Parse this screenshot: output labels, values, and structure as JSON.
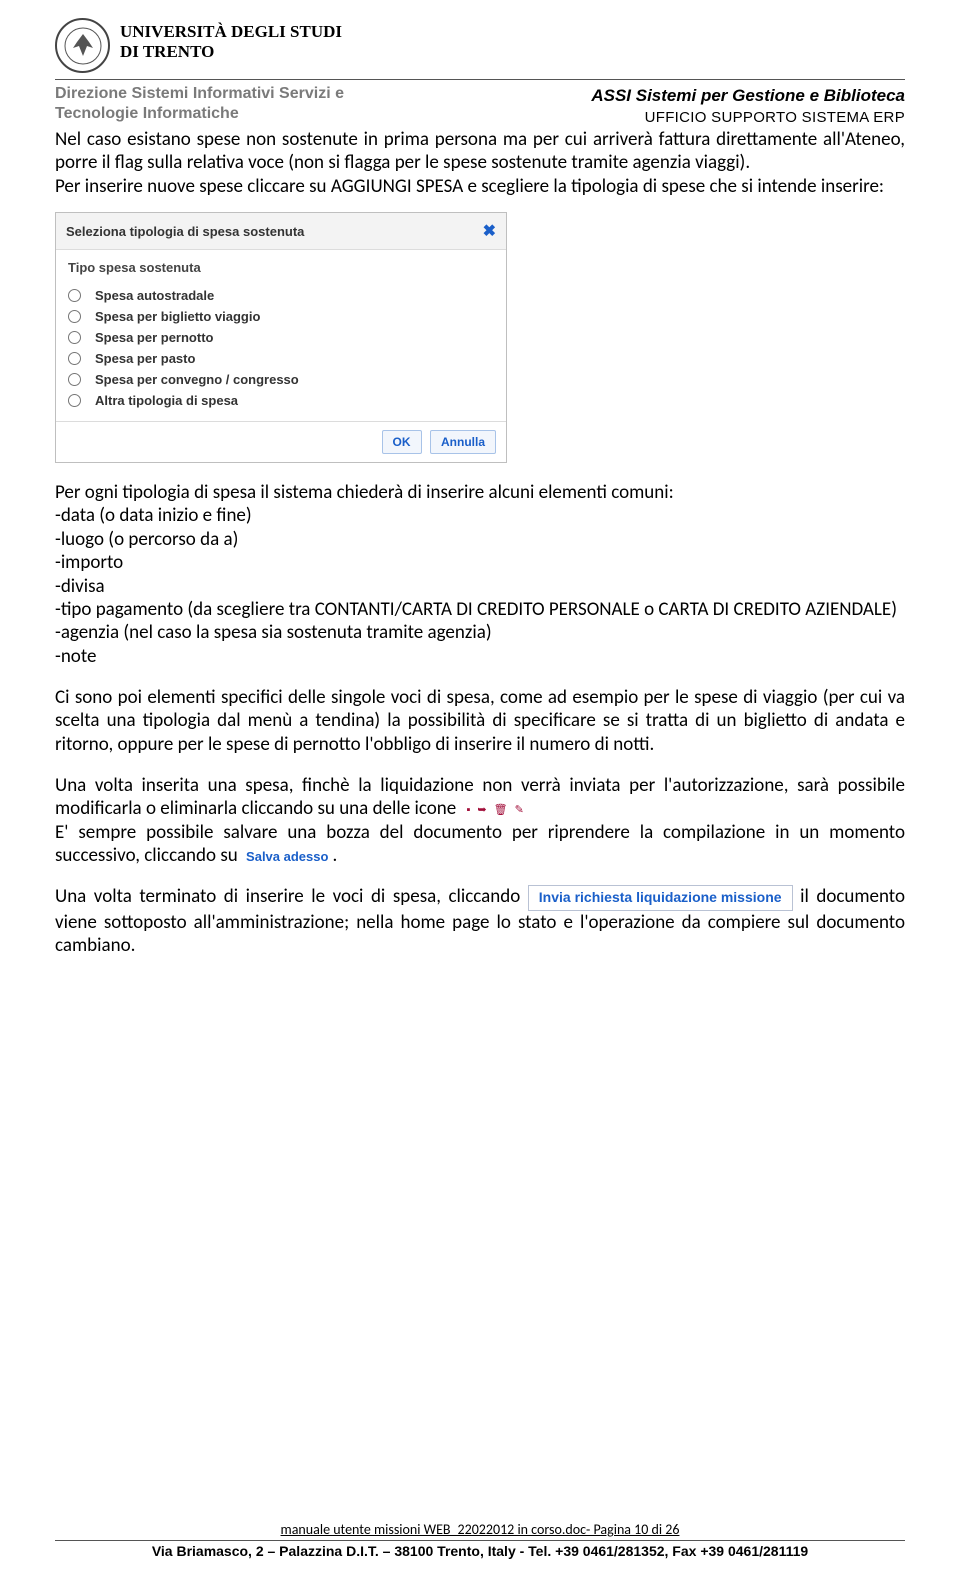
{
  "header": {
    "university_line1": "UNIVERSITÀ DEGLI STUDI",
    "university_line2": "DI TRENTO",
    "dept_line1": "Direzione Sistemi Informativi Servizi e",
    "dept_line2": "Tecnologie Informatiche",
    "assi": "ASSI Sistemi per Gestione e Biblioteca",
    "ufficio": "UFFICIO SUPPORTO SISTEMA ERP"
  },
  "p1": "Nel caso esistano spese non sostenute in prima persona ma per cui arriverà fattura direttamente all'Ateneo, porre il flag sulla relativa voce (non si flagga per le spese sostenute tramite agenzia viaggi).",
  "p2": "Per inserire nuove spese cliccare su AGGIUNGI SPESA e scegliere la tipologia di spese che si intende inserire:",
  "dialog": {
    "title": "Seleziona tipologia di spesa sostenuta",
    "subtitle": "Tipo spesa sostenuta",
    "options": [
      "Spesa autostradale",
      "Spesa per biglietto viaggio",
      "Spesa per pernotto",
      "Spesa per pasto",
      "Spesa per convegno / congresso",
      "Altra tipologia di spesa"
    ],
    "ok": "OK",
    "cancel": "Annulla"
  },
  "p3": "Per ogni tipologia di spesa il sistema chiederà di inserire alcuni elementi comuni:",
  "list": [
    "-data (o data inizio e fine)",
    "-luogo (o percorso da a)",
    "-importo",
    "-divisa",
    "-tipo pagamento (da scegliere tra CONTANTI/CARTA DI CREDITO PERSONALE o CARTA DI CREDITO AZIENDALE)",
    "-agenzia (nel caso la spesa sia sostenuta tramite agenzia)",
    "-note"
  ],
  "p4": "Ci sono poi elementi specifici delle singole voci di spesa, come ad esempio per le spese di viaggio (per cui va scelta una tipologia dal menù a tendina) la possibilità di specificare se si tratta di un biglietto di andata e ritorno, oppure per le spese di pernotto l'obbligo di inserire il numero di notti.",
  "p5a": "Una volta inserita una spesa, finchè la liquidazione non verrà inviata per l'autorizzazione, sarà possibile modificarla o eliminarla cliccando su una delle icone",
  "p5b": "E' sempre possibile salvare una bozza del documento per riprendere la compilazione in un momento successivo, cliccando su",
  "salva": "Salva adesso",
  "p6a": "Una volta terminato di inserire le voci di spesa, cliccando",
  "invia": "Invia richiesta liquidazione missione",
  "p6b": " il documento viene sottoposto all'amministrazione; nella home page lo stato e l'operazione da compiere sul documento cambiano.",
  "footer": {
    "doc": "manuale utente missioni WEB_22022012 in corso.doc- Pagina 10 di 26",
    "addr": "Via Briamasco, 2 – Palazzina D.I.T. – 38100 Trento, Italy - Tel. +39 0461/281352, Fax +39 0461/281119"
  }
}
